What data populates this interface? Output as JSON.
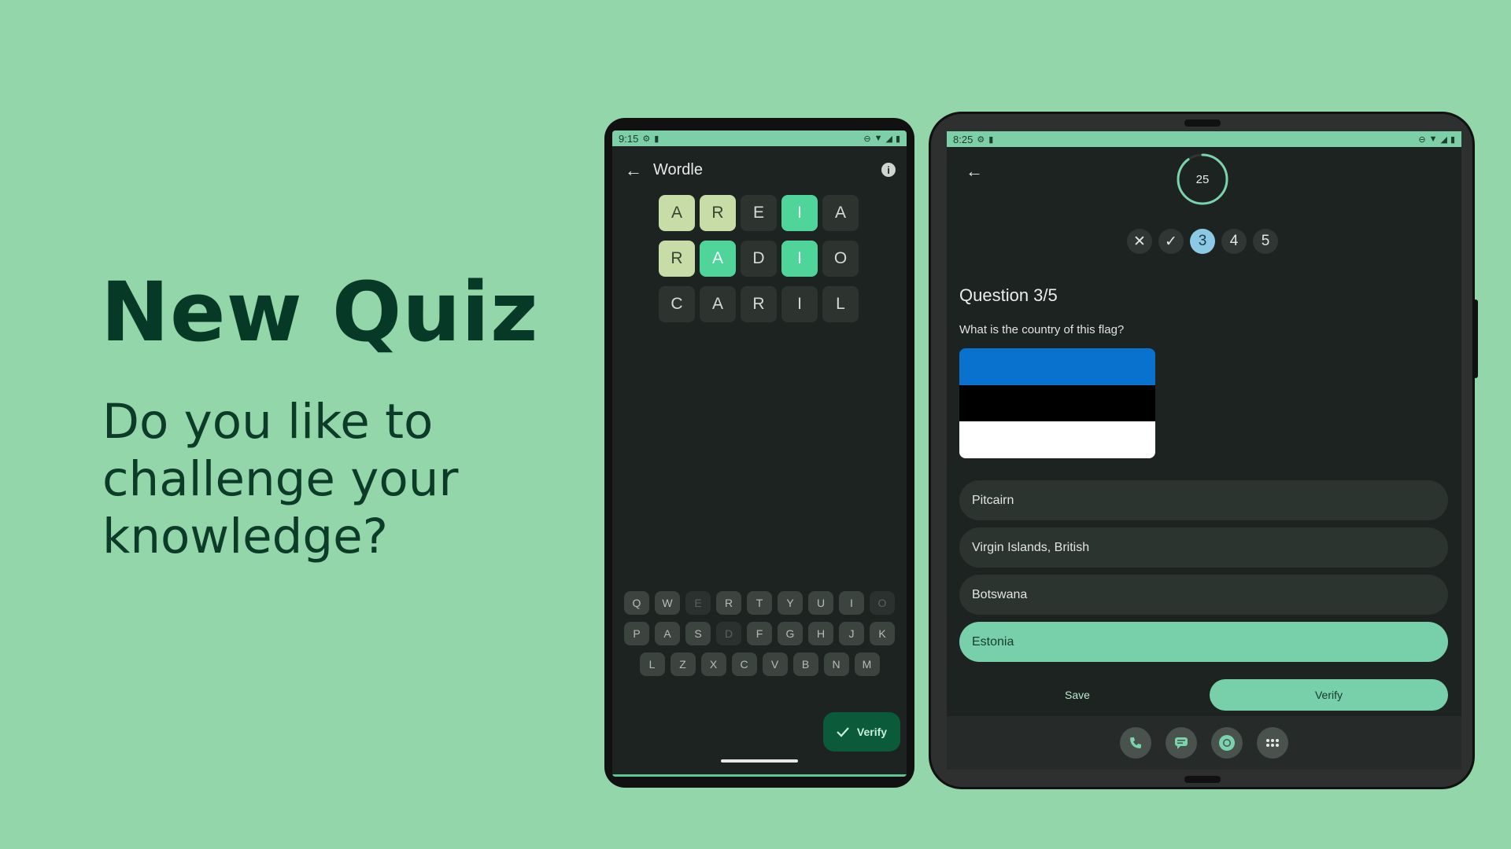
{
  "promo": {
    "title": "New Quiz",
    "subtitle": "Do you like to challenge your knowledge?"
  },
  "phone": {
    "status_time": "9:15",
    "app_title": "Wordle",
    "grid": [
      [
        {
          "l": "A",
          "s": "present"
        },
        {
          "l": "R",
          "s": "present"
        },
        {
          "l": "E",
          "s": "absent"
        },
        {
          "l": "I",
          "s": "correct"
        },
        {
          "l": "A",
          "s": "absent"
        }
      ],
      [
        {
          "l": "R",
          "s": "present"
        },
        {
          "l": "A",
          "s": "correct"
        },
        {
          "l": "D",
          "s": "absent"
        },
        {
          "l": "I",
          "s": "correct"
        },
        {
          "l": "O",
          "s": "absent"
        }
      ],
      [
        {
          "l": "C",
          "s": "absent"
        },
        {
          "l": "A",
          "s": "absent"
        },
        {
          "l": "R",
          "s": "absent"
        },
        {
          "l": "I",
          "s": "absent"
        },
        {
          "l": "L",
          "s": "absent"
        }
      ]
    ],
    "keyboard": {
      "row1": [
        "Q",
        "W",
        "E",
        "R",
        "T",
        "Y",
        "U",
        "I",
        "O"
      ],
      "row2": [
        "P",
        "A",
        "S",
        "D",
        "F",
        "G",
        "H",
        "J",
        "K"
      ],
      "row3": [
        "L",
        "Z",
        "X",
        "C",
        "V",
        "B",
        "N",
        "M"
      ],
      "used": [
        "E",
        "O",
        "D"
      ]
    },
    "verify_label": "Verify"
  },
  "tablet": {
    "status_time": "8:25",
    "timer_value": "25",
    "timer_fraction": 0.9,
    "progress": [
      {
        "label": "✕",
        "state": "wrong"
      },
      {
        "label": "✓",
        "state": "right"
      },
      {
        "label": "3",
        "state": "current"
      },
      {
        "label": "4",
        "state": "pending"
      },
      {
        "label": "5",
        "state": "pending"
      }
    ],
    "question_title": "Question 3/5",
    "question_text": "What is the country of this flag?",
    "flag_colors": [
      "#0872ce",
      "#000000",
      "#ffffff"
    ],
    "options": [
      {
        "label": "Pitcairn",
        "selected": false
      },
      {
        "label": "Virgin Islands, British",
        "selected": false
      },
      {
        "label": "Botswana",
        "selected": false
      },
      {
        "label": "Estonia",
        "selected": true
      }
    ],
    "save_label": "Save",
    "verify_label": "Verify",
    "dock": [
      "phone-icon",
      "messages-icon",
      "chrome-icon",
      "apps-icon"
    ]
  },
  "colors": {
    "background": "#92d6aa",
    "accent": "#78d0aa",
    "tile_correct": "#4fd49a",
    "tile_present": "#c8dca8"
  }
}
